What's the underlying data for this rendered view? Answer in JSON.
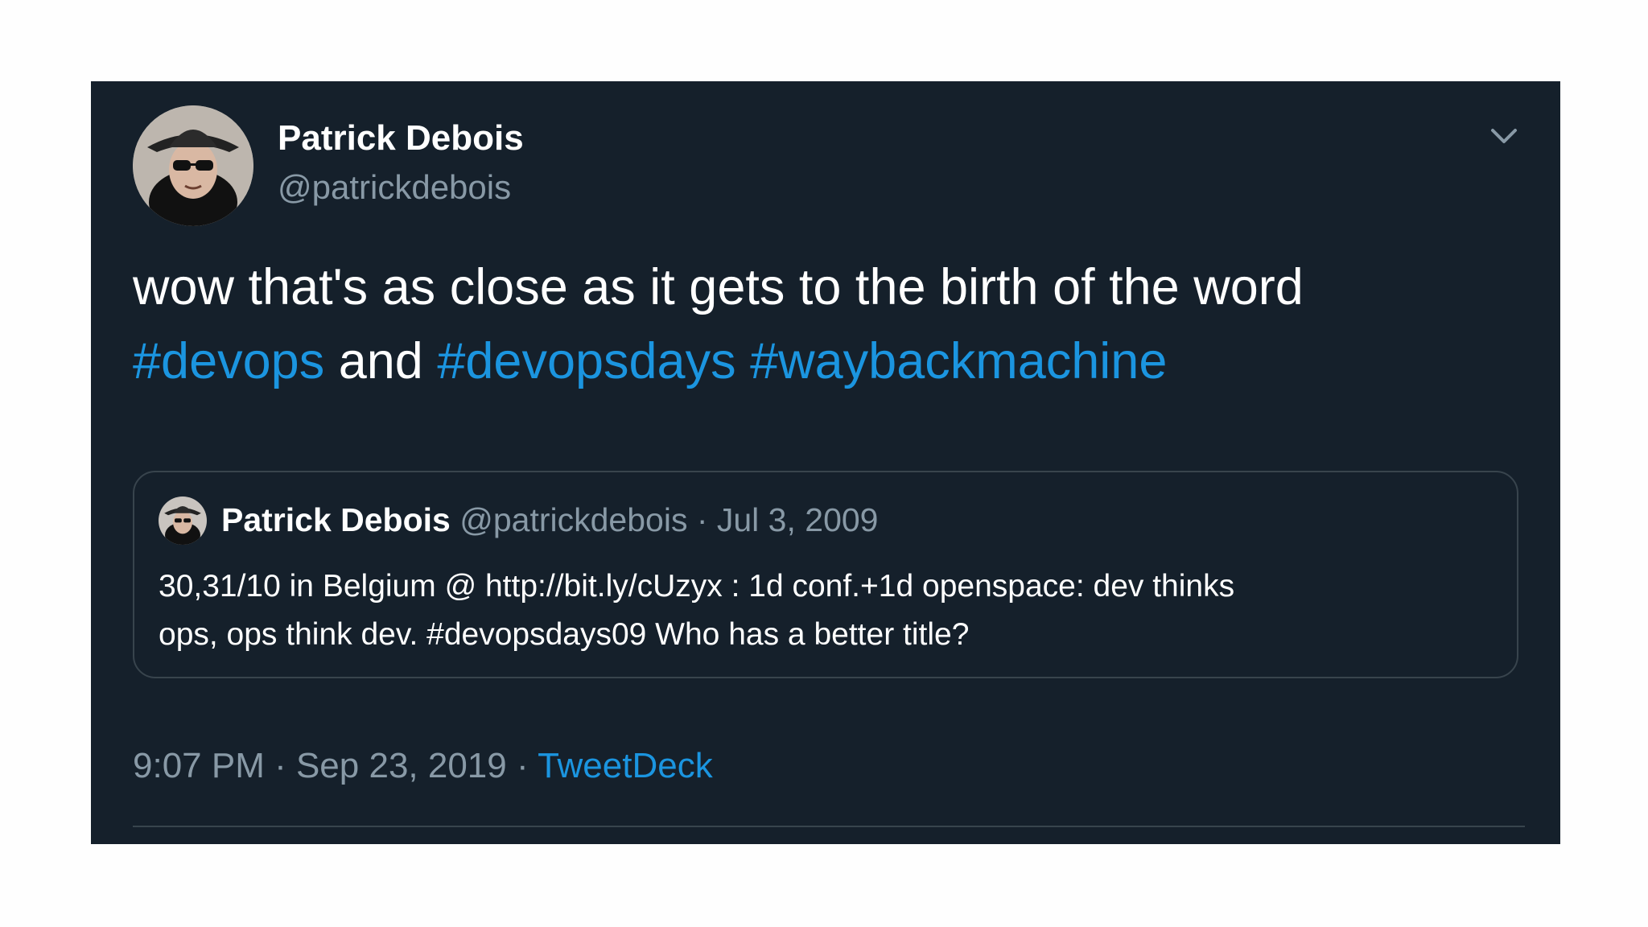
{
  "tweet": {
    "author": {
      "display_name": "Patrick Debois",
      "handle": "@patrickdebois"
    },
    "menu_icon": "chevron-down-icon",
    "text": {
      "line1": "wow that's as close as it gets to the birth of the word",
      "hashtag1": "#devops",
      "connector": " and ",
      "hashtag2": "#devopsdays",
      "hashtag3": "#waybackmachine"
    },
    "quoted": {
      "display_name": "Patrick Debois",
      "meta": "@patrickdebois · Jul 3, 2009",
      "line1": "30,31/10 in Belgium @ http://bit.ly/cUzyx : 1d conf.+1d openspace: dev thinks",
      "line2": "ops, ops think dev. #devopsdays09 Who has a better title?"
    },
    "footer": {
      "time_date": "9:07 PM · Sep 23, 2019 · ",
      "source": "TweetDeck"
    }
  },
  "colors": {
    "background": "#15202b",
    "text": "#ffffff",
    "secondary": "#8899a6",
    "link": "#1b95e0",
    "border": "#38444d"
  }
}
